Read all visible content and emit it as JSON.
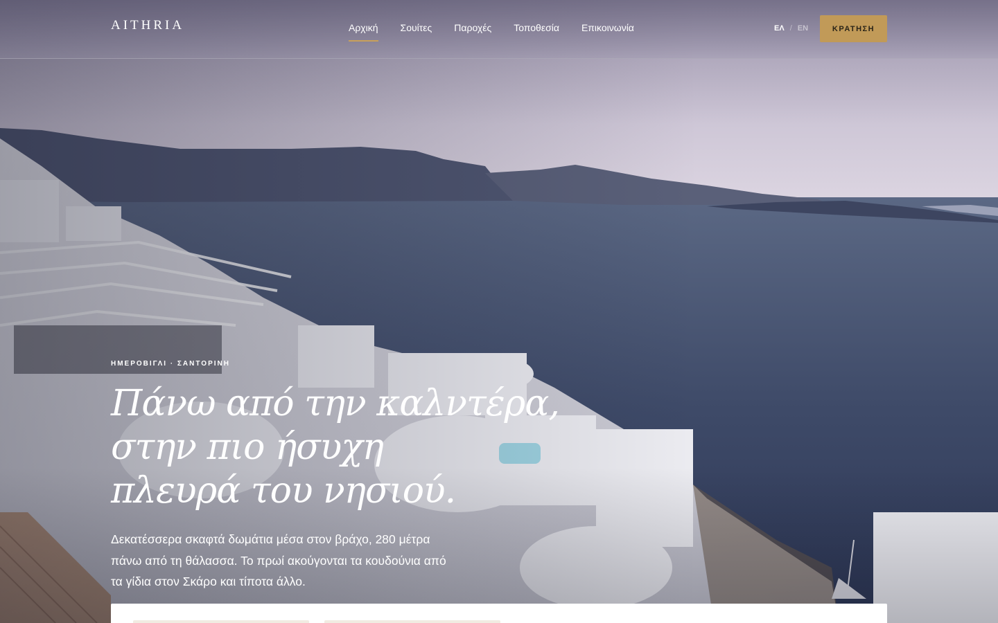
{
  "brand": {
    "name": "AITHRIA",
    "accent": "#c19a58"
  },
  "nav": {
    "items": [
      {
        "label": "Αρχική",
        "active": true
      },
      {
        "label": "Σουίτες",
        "active": false
      },
      {
        "label": "Παροχές",
        "active": false
      },
      {
        "label": "Τοποθεσία",
        "active": false
      },
      {
        "label": "Επικοινωνία",
        "active": false
      }
    ]
  },
  "lang": {
    "current": "ΕΛ",
    "separator": "/",
    "other": "EN"
  },
  "cta": {
    "book_label": "ΚΡΑΤΗΣΗ"
  },
  "hero": {
    "eyebrow": "ΗΜΕΡΟΒΙΓΛΙ · ΣΑΝΤΟΡΙΝΗ",
    "headline_lines": [
      "Πάνω από την καλντέρα,",
      "στην πιο ήσυχη",
      "πλευρά του νησιού."
    ],
    "lede": "Δεκατέσσερα σκαφτά δωμάτια μέσα στον βράχο, 280 μέτρα πάνω από τη θάλασσα. Το πρωί ακούγονται τα κουδούνια από τα γίδια στον Σκάρο και τίποτα άλλο."
  }
}
